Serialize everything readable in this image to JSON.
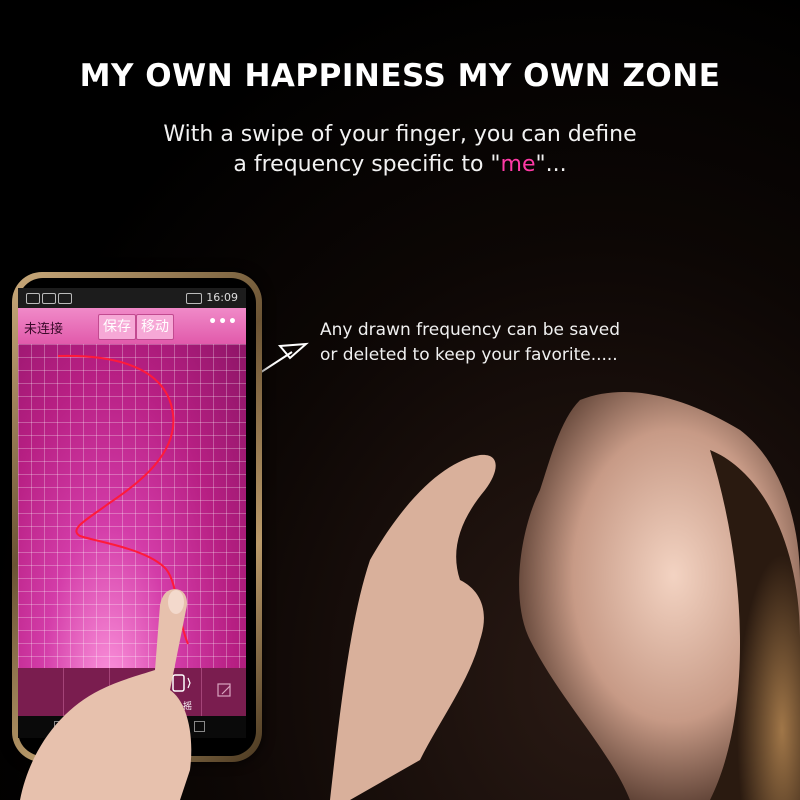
{
  "headline": "MY OWN HAPPINESS MY OWN ZONE",
  "subtitle": {
    "line1": "With a swipe of your finger, you can define",
    "line2_before": "a frequency specific to \"",
    "line2_highlight": "me",
    "line2_after": "\"..."
  },
  "note": {
    "line1": "Any drawn frequency can be saved",
    "line2": "or deleted to keep your favorite....."
  },
  "phone": {
    "status_time": "16:09",
    "toolbar": {
      "connection_label": "未连接",
      "save_label": "保存",
      "move_label": "移动",
      "more_label": "•••"
    },
    "bottom_bar": {
      "shake_label": "摇一摇"
    }
  },
  "colors": {
    "highlight": "#ff3aa6",
    "drawn_curve": "#ff1a3a",
    "toolbar": "#e15aab"
  },
  "icons": [
    "shake-icon",
    "edit-icon",
    "back-icon",
    "home-icon",
    "recent-apps-icon",
    "battery-icon"
  ]
}
